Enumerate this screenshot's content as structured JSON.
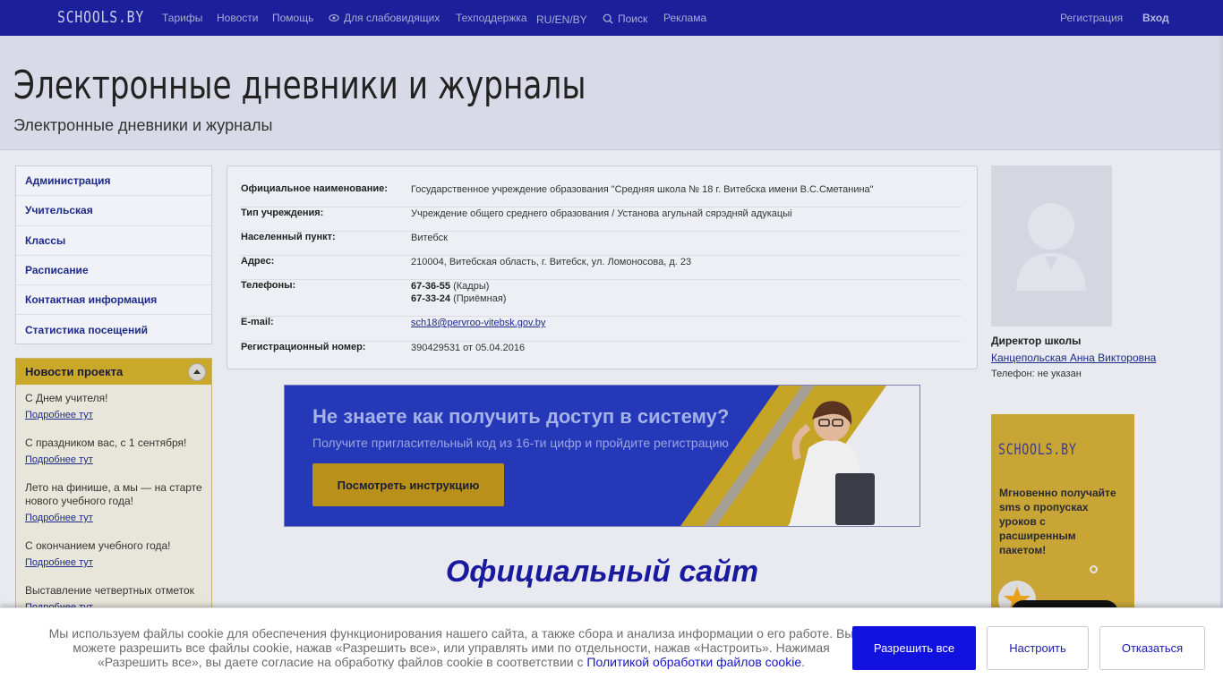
{
  "nav": {
    "logo": "SCHOOLS.BY",
    "tariffs": "Тарифы",
    "news": "Новости",
    "help": "Помощь",
    "low_vision": "Для слабовидящих",
    "support": "Техподдержка",
    "lang": "RU/EN/BY",
    "search": "Поиск",
    "ads": "Реклама",
    "register": "Регистрация",
    "login": "Вход"
  },
  "header": {
    "title": "Электронные дневники и журналы",
    "subtitle": "Электронные дневники и журналы"
  },
  "sidebar": {
    "items": [
      {
        "label": "Администрация"
      },
      {
        "label": "Учительская"
      },
      {
        "label": "Классы"
      },
      {
        "label": "Расписание"
      },
      {
        "label": "Контактная информация"
      },
      {
        "label": "Статистика посещений"
      }
    ]
  },
  "news": {
    "title": "Новости проекта",
    "more_label": "Подробнее тут",
    "items": [
      {
        "title": "С Днем учителя!"
      },
      {
        "title": "С праздником вас, с 1 сентября!"
      },
      {
        "title": "Лето на финише, а мы — на старте нового учебного года!"
      },
      {
        "title": "С окончанием учебного года!"
      },
      {
        "title": "Выставление четвертных отметок"
      }
    ]
  },
  "info": {
    "official_name_label": "Официальное наименование:",
    "official_name": "Государственное учреждение образования \"Средняя школа № 18 г. Витебска имени В.С.Сметанина\"",
    "type_label": "Тип учреждения:",
    "type": "Учреждение общего среднего образования / Установа агульнай сярэдняй адукацыі",
    "locality_label": "Населенный пункт:",
    "locality": "Витебск",
    "address_label": "Адрес:",
    "address": "210004, Витебская область, г. Витебск, ул. Ломоносова, д. 23",
    "phones_label": "Телефоны:",
    "phone1": "67-36-55",
    "phone1_note": "(Кадры)",
    "phone2": "67-33-24",
    "phone2_note": "(Приёмная)",
    "email_label": "E-mail:",
    "email": "sch18@pervroo-vitebsk.gov.by",
    "reg_label": "Регистрационный номер:",
    "reg": "390429531 от 05.04.2016"
  },
  "banner": {
    "title": "Не знаете как получить доступ в систему?",
    "subtitle": "Получите пригласительный код из 16-ти цифр и пройдите регистрацию",
    "button": "Посмотреть инструкцию"
  },
  "official_site": "Официальный сайт",
  "director": {
    "role": "Директор школы",
    "name": "Канцепольская Анна Викторовна",
    "phone": "Телефон: не указан"
  },
  "ad": {
    "logo": "SCHOOLS.BY",
    "text": "Мгновенно получайте sms о пропусках уроков с расширенным пакетом!"
  },
  "cookie": {
    "text_before": "Мы используем файлы cookie для обеспечения функционирования нашего сайта, а также сбора и анализа информации о его работе. Вы можете разрешить все файлы cookie, нажав «Разрешить все», или управлять ими по отдельности, нажав «Настроить». Нажимая «Разрешить все», вы даете согласие на обработку файлов cookie в соответствии с ",
    "link": "Политикой обработки файлов cookie",
    "text_after": ".",
    "allow": "Разрешить все",
    "configure": "Настроить",
    "decline": "Отказаться"
  },
  "colors": {
    "nav_bg": "#1b1f9a",
    "accent_gold": "#c9a82a",
    "link": "#1c2a8a",
    "cookie_primary": "#1111e0"
  }
}
